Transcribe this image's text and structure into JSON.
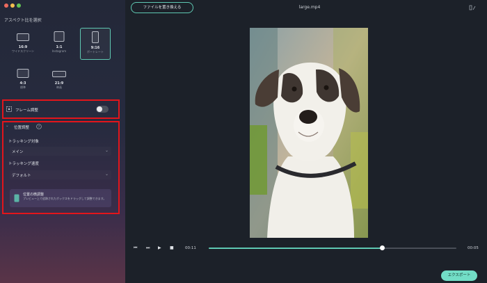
{
  "window": {
    "traffic_lights": [
      "#ed6a5e",
      "#f5bf4f",
      "#62c554"
    ]
  },
  "sidebar": {
    "aspect_title": "アスペクト比を選択",
    "aspect_options": [
      {
        "ratio": "16:9",
        "caption": "ワイドスクリーン"
      },
      {
        "ratio": "1:1",
        "caption": "Instagram"
      },
      {
        "ratio": "9:16",
        "caption": "ポートレート",
        "selected": true
      },
      {
        "ratio": "4:3",
        "caption": "標準"
      },
      {
        "ratio": "21:9",
        "caption": "映画"
      }
    ],
    "frame_adjust_label": "フレーム調整",
    "frame_adjust_on": false,
    "position_adjust_label": "位置調整",
    "tracking_target_label": "トラッキング対象",
    "tracking_target_value": "メイン",
    "tracking_speed_label": "トラッキング速度",
    "tracking_speed_value": "デフォルト",
    "hint_title": "位置の微調整",
    "hint_text": "プレビュー上で追跡されたボックスをドラッグして調整できます。",
    "highlight_color": "#e3151b",
    "accent_color": "#5fc9b3"
  },
  "main": {
    "replace_button": "ファイルを置き換える",
    "file_name": "large.mp4",
    "player": {
      "current_time": "00:11",
      "total_time": "00:05",
      "progress": 0.7
    },
    "export_button": "エクスポート"
  }
}
